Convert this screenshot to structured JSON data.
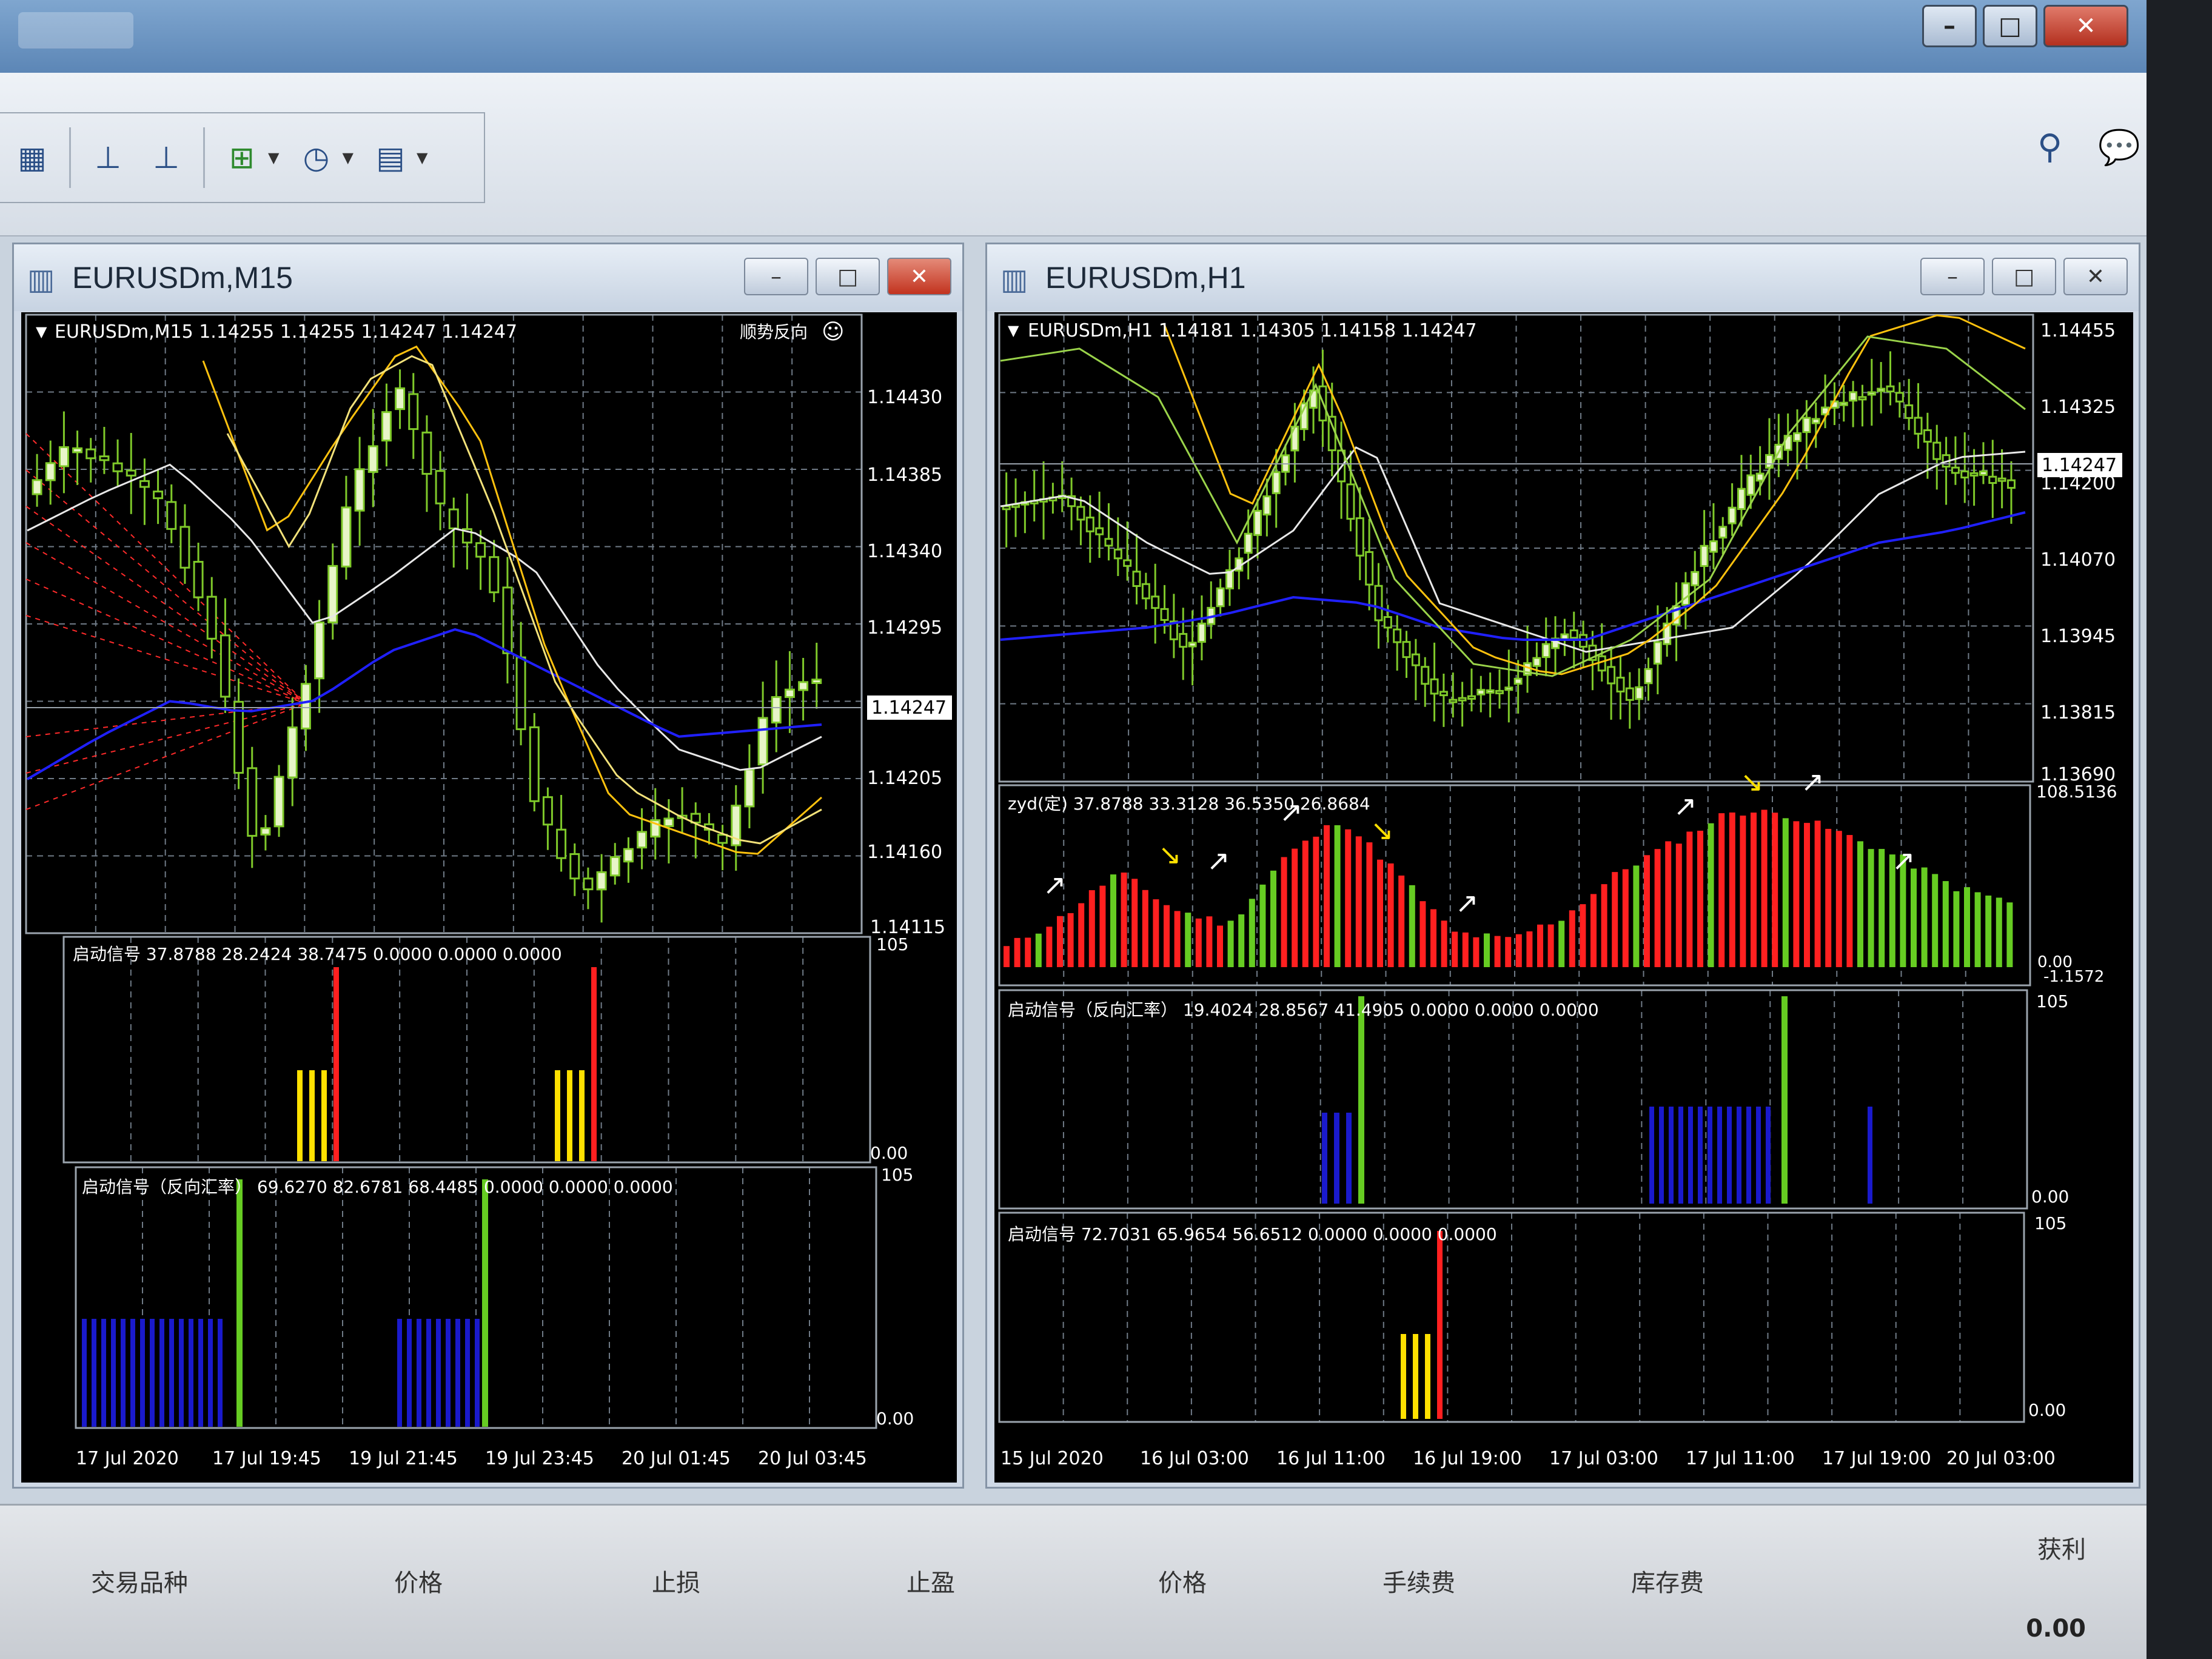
{
  "toolbar": {
    "icons": [
      "grid-icon",
      "period-separator-icon",
      "period-icon",
      "add-indicator-icon",
      "clock-icon",
      "template-icon"
    ]
  },
  "window_controls": {
    "minimize": "–",
    "maximize": "□",
    "close": "✕"
  },
  "left_chart": {
    "window_title": "EURUSDm,M15",
    "info": "EURUSDm,M15  1.14255 1.14255 1.14247 1.14247",
    "ea_label": "顺势反向",
    "price_ticks": [
      "1.14430",
      "1.14385",
      "1.14340",
      "1.14295",
      "1.14205",
      "1.14160",
      "1.14115"
    ],
    "current_price": "1.14247",
    "sub1_label": "启动信号 37.8788 28.2424 38.7475 0.0000 0.0000 0.0000",
    "sub1_scale_top": "105",
    "sub1_scale_bottom": "0.00",
    "sub2_label": "启动信号（反向汇率） 69.6270 82.6781 68.4485 0.0000 0.0000 0.0000",
    "sub2_scale_top": "105",
    "sub2_scale_bottom": "0.00",
    "time_ticks": [
      "17 Jul 2020",
      "17 Jul 19:45",
      "19 Jul 21:45",
      "19 Jul 23:45",
      "20 Jul 01:45",
      "20 Jul 03:45"
    ]
  },
  "right_chart": {
    "window_title": "EURUSDm,H1",
    "info": "EURUSDm,H1  1.14181 1.14305 1.14158 1.14247",
    "price_ticks": [
      "1.14455",
      "1.14325",
      "1.14200",
      "1.14070",
      "1.13945",
      "1.13815",
      "1.13690"
    ],
    "current_price": "1.14247",
    "osc_label": "zyd(定) 37.8788 33.3128 36.5350 26.8684",
    "osc_scale_top": "108.5136",
    "osc_scale_bottom": "0.00",
    "osc_scale_extra": "-1.1572",
    "sub1_label": "启动信号（反向汇率） 19.4024 28.8567 41.4905 0.0000 0.0000 0.0000",
    "sub1_scale_top": "105",
    "sub1_scale_bottom": "0.00",
    "sub2_label": "启动信号 72.7031 65.9654 56.6512 0.0000 0.0000 0.0000",
    "sub2_scale_top": "105",
    "sub2_scale_bottom": "0.00",
    "time_ticks": [
      "15 Jul 2020",
      "16 Jul 03:00",
      "16 Jul 11:00",
      "16 Jul 19:00",
      "17 Jul 03:00",
      "17 Jul 11:00",
      "17 Jul 19:00",
      "20 Jul 03:00"
    ]
  },
  "terminal": {
    "columns": [
      "交易品种",
      "价格",
      "止损",
      "止盈",
      "价格",
      "手续费",
      "库存费",
      "获利"
    ],
    "profit_value": "0.00"
  },
  "colors": {
    "bull": "#7fc92a",
    "bull_body": "#e8f5c8",
    "ma_white": "#e8e8e8",
    "ma_blue": "#2020ff",
    "ma_yellow": "#ffc20e",
    "signal_red": "#ff2020",
    "signal_yellow": "#ffe000",
    "signal_green": "#66cc22",
    "signal_blue": "#1a1acc"
  }
}
